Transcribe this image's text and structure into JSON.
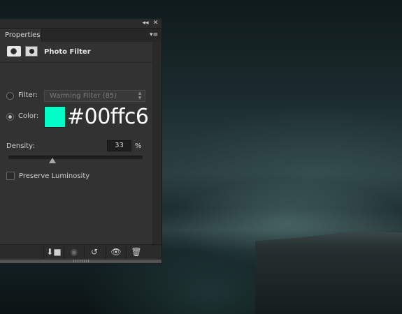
{
  "panel": {
    "collapse_glyph": "◂◂",
    "close_glyph": "✕",
    "tab_label": "Properties",
    "menu_glyph": "▾≡",
    "adjustment_title": "Photo Filter",
    "adjustment_icon": "photo-filter-icon",
    "mask_icon": "layer-mask-icon"
  },
  "filter": {
    "label": "Filter:",
    "selected": "Warming Filter (85)",
    "enabled": false
  },
  "color": {
    "label": "Color:",
    "swatch": "#00ffc6",
    "hex_text": "#00ffc6",
    "enabled": true
  },
  "density": {
    "label": "Density:",
    "value": "33",
    "unit": "%",
    "slider_fraction": 0.33
  },
  "preserve_luminosity": {
    "label": "Preserve Luminosity",
    "checked": false
  },
  "bottom_toolbar": {
    "clip_to_layer_icon": "clip-to-layer-icon",
    "view_previous_icon": "view-previous-state-icon",
    "reset_icon": "reset-icon",
    "visibility_icon": "eye-icon",
    "delete_icon": "trash-icon"
  }
}
